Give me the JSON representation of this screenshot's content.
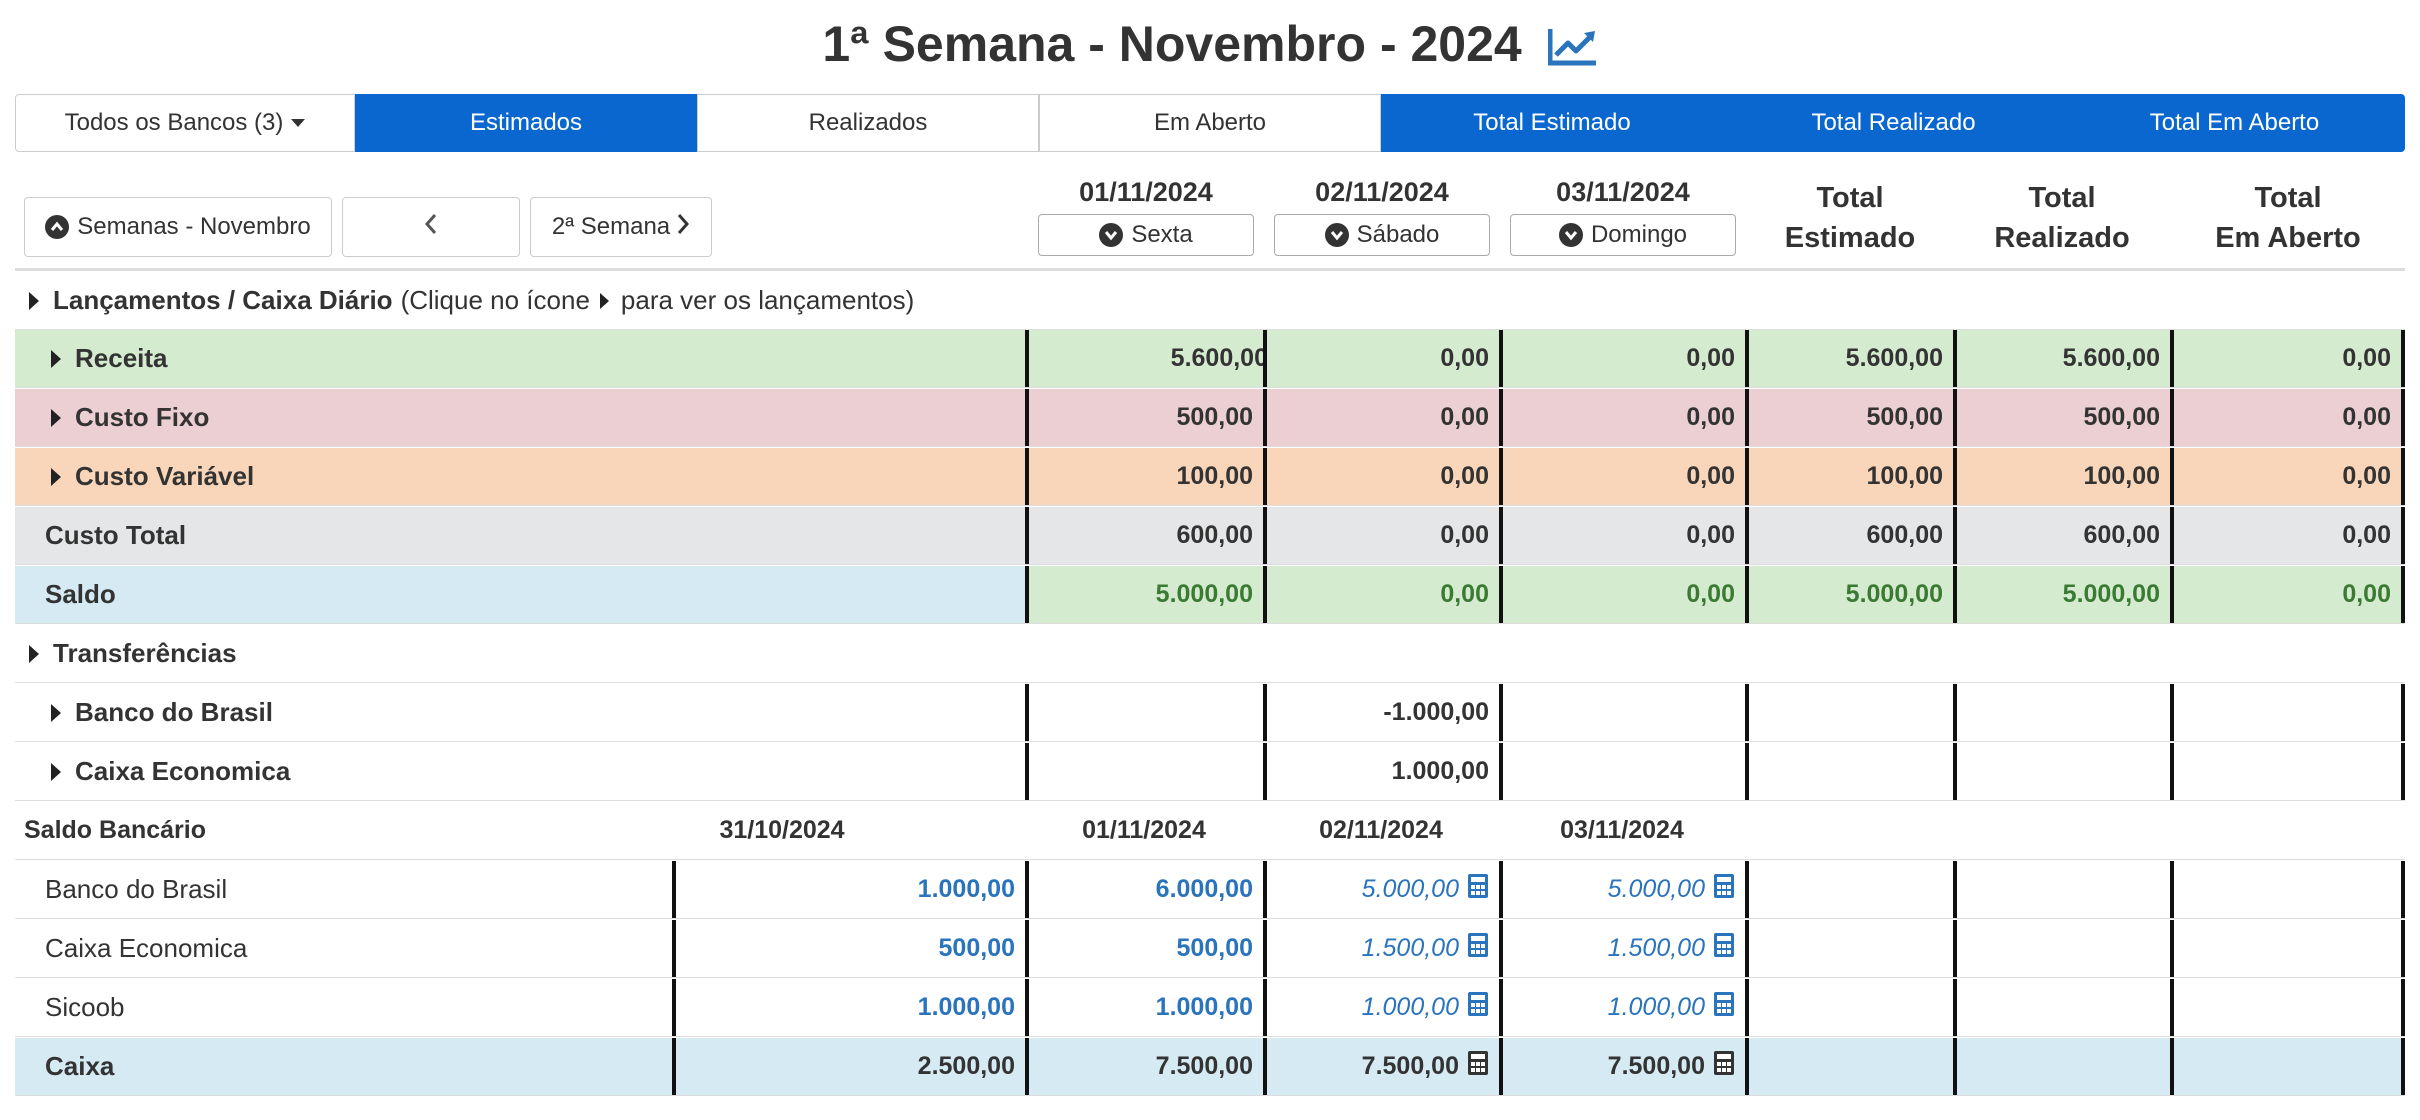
{
  "title": "1ª Semana - Novembro - 2024",
  "title_icon": "line-chart-icon",
  "filters": {
    "banks": "Todos os Bancos (3)",
    "estimados": "Estimados",
    "realizados": "Realizados",
    "em_aberto": "Em Aberto",
    "total_estimado": "Total Estimado",
    "total_realizado": "Total Realizado",
    "total_em_aberto": "Total Em Aberto"
  },
  "nav": {
    "weeks": "Semanas - Novembro",
    "prev": "<",
    "next": "2ª Semana"
  },
  "days": [
    {
      "date": "01/11/2024",
      "weekday": "Sexta"
    },
    {
      "date": "02/11/2024",
      "weekday": "Sábado"
    },
    {
      "date": "03/11/2024",
      "weekday": "Domingo"
    }
  ],
  "totals_header": {
    "estimado": [
      "Total",
      "Estimado"
    ],
    "realizado": [
      "Total",
      "Realizado"
    ],
    "em_aberto": [
      "Total",
      "Em Aberto"
    ]
  },
  "lancamentos": {
    "title": "Lançamentos / Caixa Diário",
    "hint_before": "(Clique no ícone",
    "hint_after": "para ver os lançamentos)"
  },
  "rows": {
    "receita": {
      "label": "Receita",
      "values": [
        "5.600,00",
        "0,00",
        "0,00",
        "5.600,00",
        "5.600,00",
        "0,00"
      ]
    },
    "custo_fixo": {
      "label": "Custo Fixo",
      "values": [
        "500,00",
        "0,00",
        "0,00",
        "500,00",
        "500,00",
        "0,00"
      ]
    },
    "custo_variavel": {
      "label": "Custo Variável",
      "values": [
        "100,00",
        "0,00",
        "0,00",
        "100,00",
        "100,00",
        "0,00"
      ]
    },
    "custo_total": {
      "label": "Custo Total",
      "values": [
        "600,00",
        "0,00",
        "0,00",
        "600,00",
        "600,00",
        "0,00"
      ]
    },
    "saldo": {
      "label": "Saldo",
      "values": [
        "5.000,00",
        "0,00",
        "0,00",
        "5.000,00",
        "5.000,00",
        "0,00"
      ]
    }
  },
  "transferencias": {
    "title": "Transferências",
    "banco_brasil": {
      "label": "Banco do Brasil",
      "value": "-1.000,00"
    },
    "caixa_economica": {
      "label": "Caixa Economica",
      "value": "1.000,00"
    }
  },
  "saldo_bancario": {
    "title": "Saldo Bancário",
    "dates": [
      "31/10/2024",
      "01/11/2024",
      "02/11/2024",
      "03/11/2024"
    ],
    "banks": [
      {
        "name": "Banco do Brasil",
        "values": [
          "1.000,00",
          "6.000,00",
          "5.000,00",
          "5.000,00"
        ]
      },
      {
        "name": "Caixa Economica",
        "values": [
          "500,00",
          "500,00",
          "1.500,00",
          "1.500,00"
        ]
      },
      {
        "name": "Sicoob",
        "values": [
          "1.000,00",
          "1.000,00",
          "1.000,00",
          "1.000,00"
        ]
      }
    ],
    "caixa": {
      "name": "Caixa",
      "values": [
        "2.500,00",
        "7.500,00",
        "7.500,00",
        "7.500,00"
      ]
    }
  },
  "colors": {
    "primary": "#0a67cf",
    "receita": "#d5ebd0",
    "custo_fixo": "#eccfd3",
    "custo_variavel": "#f9d6b9",
    "custo_total": "#e5e6e8",
    "saldo_label": "#d6eaf4",
    "positive": "#3a7a32",
    "balance": "#2a73bd"
  }
}
